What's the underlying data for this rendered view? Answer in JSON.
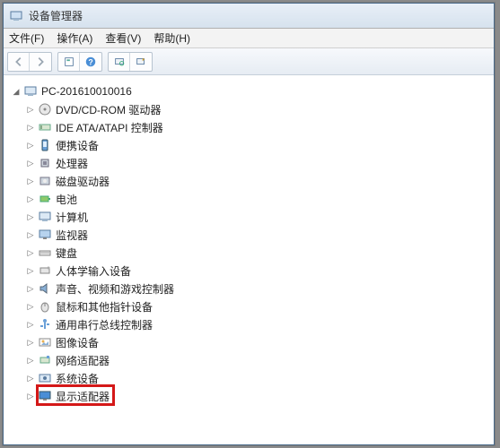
{
  "window": {
    "title": "设备管理器"
  },
  "menu": {
    "file": "文件(F)",
    "action": "操作(A)",
    "view": "查看(V)",
    "help": "帮助(H)"
  },
  "toolbar": {
    "back": "back",
    "forward": "forward",
    "up": "properties",
    "help": "help",
    "refresh": "refresh",
    "scan": "scan"
  },
  "tree": {
    "root": "PC-201610010016",
    "items": [
      {
        "label": "DVD/CD-ROM 驱动器",
        "icon": "disc"
      },
      {
        "label": "IDE ATA/ATAPI 控制器",
        "icon": "ide"
      },
      {
        "label": "便携设备",
        "icon": "portable"
      },
      {
        "label": "处理器",
        "icon": "cpu"
      },
      {
        "label": "磁盘驱动器",
        "icon": "disk"
      },
      {
        "label": "电池",
        "icon": "battery"
      },
      {
        "label": "计算机",
        "icon": "computer"
      },
      {
        "label": "监视器",
        "icon": "monitor"
      },
      {
        "label": "键盘",
        "icon": "keyboard"
      },
      {
        "label": "人体学输入设备",
        "icon": "hid"
      },
      {
        "label": "声音、视频和游戏控制器",
        "icon": "sound"
      },
      {
        "label": "鼠标和其他指针设备",
        "icon": "mouse"
      },
      {
        "label": "通用串行总线控制器",
        "icon": "usb"
      },
      {
        "label": "图像设备",
        "icon": "image"
      },
      {
        "label": "网络适配器",
        "icon": "network"
      },
      {
        "label": "系统设备",
        "icon": "system"
      },
      {
        "label": "显示适配器",
        "icon": "display"
      }
    ]
  },
  "highlight_index": 16
}
